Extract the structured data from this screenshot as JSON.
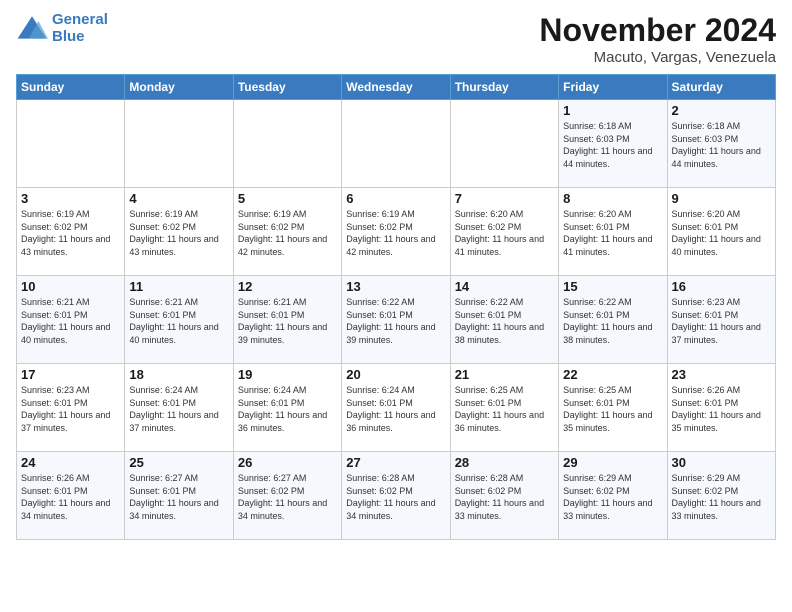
{
  "logo": {
    "line1": "General",
    "line2": "Blue"
  },
  "title": "November 2024",
  "subtitle": "Macuto, Vargas, Venezuela",
  "days_of_week": [
    "Sunday",
    "Monday",
    "Tuesday",
    "Wednesday",
    "Thursday",
    "Friday",
    "Saturday"
  ],
  "weeks": [
    [
      {
        "day": "",
        "info": ""
      },
      {
        "day": "",
        "info": ""
      },
      {
        "day": "",
        "info": ""
      },
      {
        "day": "",
        "info": ""
      },
      {
        "day": "",
        "info": ""
      },
      {
        "day": "1",
        "info": "Sunrise: 6:18 AM\nSunset: 6:03 PM\nDaylight: 11 hours and 44 minutes."
      },
      {
        "day": "2",
        "info": "Sunrise: 6:18 AM\nSunset: 6:03 PM\nDaylight: 11 hours and 44 minutes."
      }
    ],
    [
      {
        "day": "3",
        "info": "Sunrise: 6:19 AM\nSunset: 6:02 PM\nDaylight: 11 hours and 43 minutes."
      },
      {
        "day": "4",
        "info": "Sunrise: 6:19 AM\nSunset: 6:02 PM\nDaylight: 11 hours and 43 minutes."
      },
      {
        "day": "5",
        "info": "Sunrise: 6:19 AM\nSunset: 6:02 PM\nDaylight: 11 hours and 42 minutes."
      },
      {
        "day": "6",
        "info": "Sunrise: 6:19 AM\nSunset: 6:02 PM\nDaylight: 11 hours and 42 minutes."
      },
      {
        "day": "7",
        "info": "Sunrise: 6:20 AM\nSunset: 6:02 PM\nDaylight: 11 hours and 41 minutes."
      },
      {
        "day": "8",
        "info": "Sunrise: 6:20 AM\nSunset: 6:01 PM\nDaylight: 11 hours and 41 minutes."
      },
      {
        "day": "9",
        "info": "Sunrise: 6:20 AM\nSunset: 6:01 PM\nDaylight: 11 hours and 40 minutes."
      }
    ],
    [
      {
        "day": "10",
        "info": "Sunrise: 6:21 AM\nSunset: 6:01 PM\nDaylight: 11 hours and 40 minutes."
      },
      {
        "day": "11",
        "info": "Sunrise: 6:21 AM\nSunset: 6:01 PM\nDaylight: 11 hours and 40 minutes."
      },
      {
        "day": "12",
        "info": "Sunrise: 6:21 AM\nSunset: 6:01 PM\nDaylight: 11 hours and 39 minutes."
      },
      {
        "day": "13",
        "info": "Sunrise: 6:22 AM\nSunset: 6:01 PM\nDaylight: 11 hours and 39 minutes."
      },
      {
        "day": "14",
        "info": "Sunrise: 6:22 AM\nSunset: 6:01 PM\nDaylight: 11 hours and 38 minutes."
      },
      {
        "day": "15",
        "info": "Sunrise: 6:22 AM\nSunset: 6:01 PM\nDaylight: 11 hours and 38 minutes."
      },
      {
        "day": "16",
        "info": "Sunrise: 6:23 AM\nSunset: 6:01 PM\nDaylight: 11 hours and 37 minutes."
      }
    ],
    [
      {
        "day": "17",
        "info": "Sunrise: 6:23 AM\nSunset: 6:01 PM\nDaylight: 11 hours and 37 minutes."
      },
      {
        "day": "18",
        "info": "Sunrise: 6:24 AM\nSunset: 6:01 PM\nDaylight: 11 hours and 37 minutes."
      },
      {
        "day": "19",
        "info": "Sunrise: 6:24 AM\nSunset: 6:01 PM\nDaylight: 11 hours and 36 minutes."
      },
      {
        "day": "20",
        "info": "Sunrise: 6:24 AM\nSunset: 6:01 PM\nDaylight: 11 hours and 36 minutes."
      },
      {
        "day": "21",
        "info": "Sunrise: 6:25 AM\nSunset: 6:01 PM\nDaylight: 11 hours and 36 minutes."
      },
      {
        "day": "22",
        "info": "Sunrise: 6:25 AM\nSunset: 6:01 PM\nDaylight: 11 hours and 35 minutes."
      },
      {
        "day": "23",
        "info": "Sunrise: 6:26 AM\nSunset: 6:01 PM\nDaylight: 11 hours and 35 minutes."
      }
    ],
    [
      {
        "day": "24",
        "info": "Sunrise: 6:26 AM\nSunset: 6:01 PM\nDaylight: 11 hours and 34 minutes."
      },
      {
        "day": "25",
        "info": "Sunrise: 6:27 AM\nSunset: 6:01 PM\nDaylight: 11 hours and 34 minutes."
      },
      {
        "day": "26",
        "info": "Sunrise: 6:27 AM\nSunset: 6:02 PM\nDaylight: 11 hours and 34 minutes."
      },
      {
        "day": "27",
        "info": "Sunrise: 6:28 AM\nSunset: 6:02 PM\nDaylight: 11 hours and 34 minutes."
      },
      {
        "day": "28",
        "info": "Sunrise: 6:28 AM\nSunset: 6:02 PM\nDaylight: 11 hours and 33 minutes."
      },
      {
        "day": "29",
        "info": "Sunrise: 6:29 AM\nSunset: 6:02 PM\nDaylight: 11 hours and 33 minutes."
      },
      {
        "day": "30",
        "info": "Sunrise: 6:29 AM\nSunset: 6:02 PM\nDaylight: 11 hours and 33 minutes."
      }
    ]
  ]
}
